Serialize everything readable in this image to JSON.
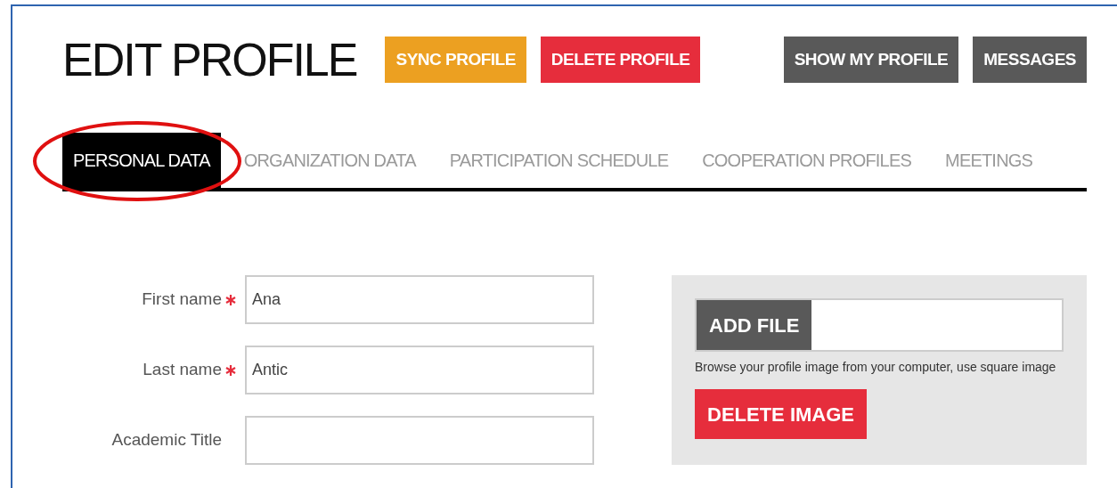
{
  "title": "EDIT PROFILE",
  "header_buttons": [
    {
      "label": "SYNC PROFILE",
      "kind": "sync"
    },
    {
      "label": "DELETE PROFILE",
      "kind": "danger"
    },
    {
      "label": "SHOW MY PROFILE",
      "kind": "dark"
    },
    {
      "label": "MESSAGES",
      "kind": "dark"
    }
  ],
  "tabs": [
    {
      "label": "PERSONAL DATA",
      "selected": true,
      "annotated": true
    },
    {
      "label": "ORGANIZATION DATA",
      "selected": false,
      "annotated": false
    },
    {
      "label": "PARTICIPATION SCHEDULE",
      "selected": false,
      "annotated": false
    },
    {
      "label": "COOPERATION PROFILES",
      "selected": false,
      "annotated": false
    },
    {
      "label": "MEETINGS",
      "selected": false,
      "annotated": false
    }
  ],
  "fields": [
    {
      "label": "First name",
      "required": true,
      "value": "Ana"
    },
    {
      "label": "Last name",
      "required": true,
      "value": "Antic"
    },
    {
      "label": "Academic Title",
      "required": false
    }
  ],
  "image_panel": {
    "add_file": "ADD FILE",
    "help": "Browse your profile image from your computer, use square image",
    "delete": "DELETE IMAGE"
  }
}
